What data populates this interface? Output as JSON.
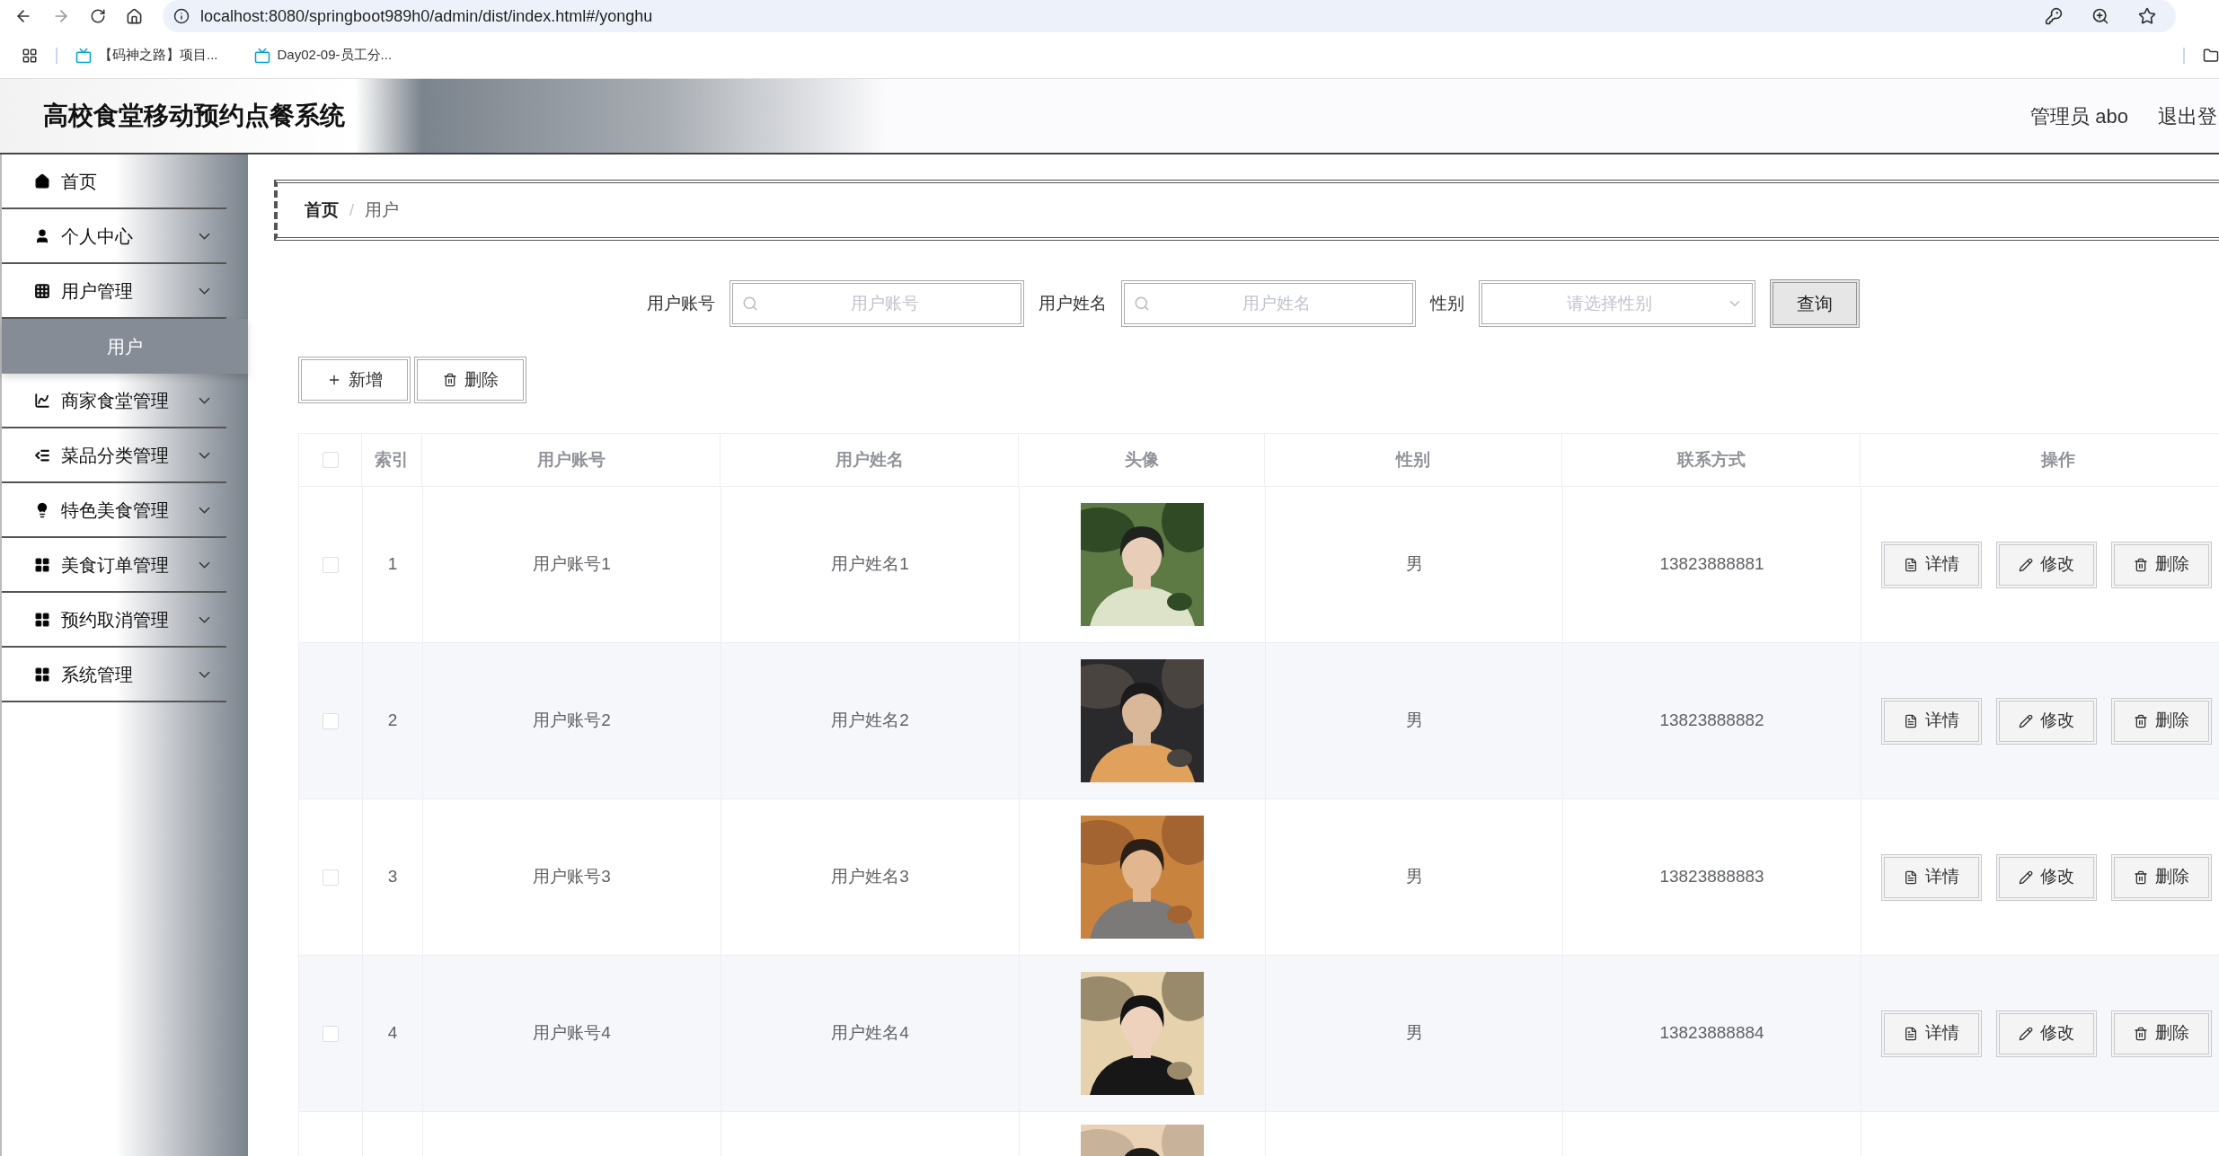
{
  "browser": {
    "url": "localhost:8080/springboot989h0/admin/dist/index.html#/yonghu",
    "bookmarks": [
      "【码神之路】项目...",
      "Day02-09-员工分..."
    ]
  },
  "header": {
    "title": "高校食堂移动预约点餐系统",
    "user": "管理员 abo",
    "logout": "退出登"
  },
  "sidebar": {
    "items": [
      {
        "label": "首页",
        "kind": "home",
        "dropdown": false
      },
      {
        "label": "个人中心",
        "kind": "user",
        "dropdown": true
      },
      {
        "label": "用户管理",
        "kind": "grid",
        "dropdown": true,
        "children": [
          {
            "label": "用户",
            "selected": true
          }
        ]
      },
      {
        "label": "商家食堂管理",
        "kind": "chart",
        "dropdown": true
      },
      {
        "label": "菜品分类管理",
        "kind": "list",
        "dropdown": true
      },
      {
        "label": "特色美食管理",
        "kind": "bulb",
        "dropdown": true
      },
      {
        "label": "美食订单管理",
        "kind": "tiles",
        "dropdown": true
      },
      {
        "label": "预约取消管理",
        "kind": "tiles",
        "dropdown": true
      },
      {
        "label": "系统管理",
        "kind": "tiles",
        "dropdown": true
      }
    ]
  },
  "breadcrumb": [
    {
      "label": "首页",
      "current": false,
      "separator": "/"
    },
    {
      "label": "用户",
      "current": true
    }
  ],
  "search": {
    "fields": [
      {
        "label": "用户账号",
        "placeholder": "用户账号",
        "kind": "text"
      },
      {
        "label": "用户姓名",
        "placeholder": "用户姓名",
        "kind": "text"
      },
      {
        "label": "性别",
        "placeholder": "请选择性别",
        "kind": "select"
      }
    ],
    "button": "查询"
  },
  "toolbar": [
    {
      "label": "新增",
      "kind": "add"
    },
    {
      "label": "删除",
      "kind": "delete"
    }
  ],
  "table": {
    "header_checked": false,
    "columns": [
      "索引",
      "用户账号",
      "用户姓名",
      "头像",
      "性别",
      "联系方式",
      "操作"
    ],
    "rows": [
      {
        "checked": false,
        "index": "1",
        "account": "用户账号1",
        "name": "用户姓名1",
        "avatar": {
          "kind": "picture"
        },
        "gender": "男",
        "phone": "13823888881",
        "actions": [
          {
            "label": "详情",
            "kind": "detail"
          },
          {
            "label": "修改",
            "kind": "edit"
          },
          {
            "label": "删除",
            "kind": "delete"
          }
        ]
      },
      {
        "checked": false,
        "index": "2",
        "account": "用户账号2",
        "name": "用户姓名2",
        "avatar": {
          "kind": "picture"
        },
        "gender": "男",
        "phone": "13823888882",
        "actions": [
          {
            "label": "详情",
            "kind": "detail"
          },
          {
            "label": "修改",
            "kind": "edit"
          },
          {
            "label": "删除",
            "kind": "delete"
          }
        ]
      },
      {
        "checked": false,
        "index": "3",
        "account": "用户账号3",
        "name": "用户姓名3",
        "avatar": {
          "kind": "picture"
        },
        "gender": "男",
        "phone": "13823888883",
        "actions": [
          {
            "label": "详情",
            "kind": "detail"
          },
          {
            "label": "修改",
            "kind": "edit"
          },
          {
            "label": "删除",
            "kind": "delete"
          }
        ]
      },
      {
        "checked": false,
        "index": "4",
        "account": "用户账号4",
        "name": "用户姓名4",
        "avatar": {
          "kind": "picture"
        },
        "gender": "男",
        "phone": "13823888884",
        "actions": [
          {
            "label": "详情",
            "kind": "detail"
          },
          {
            "label": "修改",
            "kind": "edit"
          },
          {
            "label": "删除",
            "kind": "delete"
          }
        ]
      },
      {
        "avatar": {
          "kind": "picture"
        }
      }
    ]
  }
}
